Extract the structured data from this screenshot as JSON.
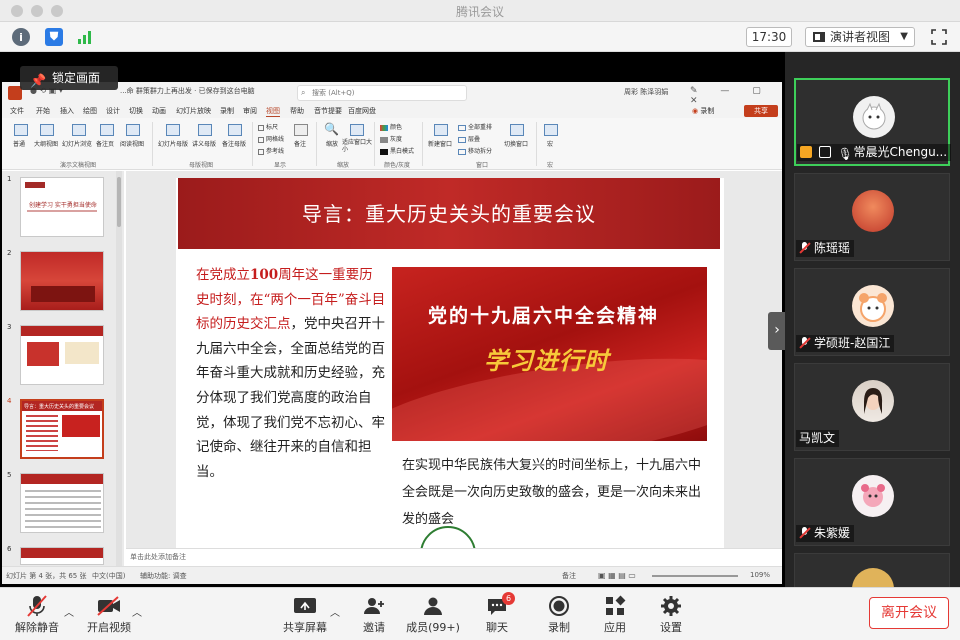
{
  "window": {
    "title": "腾讯会议"
  },
  "toolbar": {
    "time": "17:30",
    "view_mode": "演讲者视图"
  },
  "share": {
    "lock_label": "锁定画面"
  },
  "ppt": {
    "doc_title": "...命 群策群力上再出发 · 已保存到这台电脑",
    "search_placeholder": "搜索 (Alt+Q)",
    "user": "周彩 陈泽羽娟",
    "menu": [
      "文件",
      "开始",
      "插入",
      "绘图",
      "设计",
      "切换",
      "动画",
      "幻灯片放映",
      "录制",
      "审阅",
      "视图",
      "帮助",
      "音节提要",
      "百度网盘"
    ],
    "active_menu": "视图",
    "record_label": "录制",
    "share_label": "共享",
    "ribbon": {
      "presentation_views": [
        "普通",
        "大纲视图",
        "幻灯片浏览",
        "备注页",
        "阅读视图"
      ],
      "group_presentation": "演示文稿视图",
      "master_views": [
        "幻灯片母版",
        "讲义母版",
        "备注母版"
      ],
      "group_master": "母版视图",
      "show_items": [
        "标尺",
        "网格线",
        "参考线"
      ],
      "notes_label": "备注",
      "group_show": "显示",
      "zoom_items": [
        "缩放",
        "适应窗口大小"
      ],
      "group_zoom": "缩放",
      "color_items": [
        "颜色",
        "灰度",
        "黑白模式"
      ],
      "group_color": "颜色/灰度",
      "window_items": [
        "新建窗口",
        "全部重排",
        "层叠",
        "移动拆分",
        "切换窗口"
      ],
      "group_window": "窗口",
      "macro_label": "宏",
      "group_macro": "宏"
    },
    "slide_numbers": [
      "1",
      "2",
      "3",
      "4",
      "5",
      "6"
    ],
    "thumb1_title": "创建学习 实干勇担当使命",
    "thumb4_title": "导言：重大历史关头的重要会议",
    "notes_placeholder": "单击此处添加备注",
    "status": {
      "slide_info": "幻灯片 第 4 张，共 65 张",
      "language": "中文(中国)",
      "accessibility": "辅助功能: 调查",
      "notes": "备注",
      "zoom": "109%"
    }
  },
  "slide": {
    "title": "导言：重大历史关头的重要会议",
    "left_red_1": "在党成立",
    "left_red_bold": "100",
    "left_red_2": "周年这一重要历史时刻，在“两个一百年”奋斗目标的历史交汇点",
    "left_black": "，党中央召开十九届六中全会，全面总结党的百年奋斗重大成就和历史经验，充分体现了我们党高度的政治自觉，体现了我们党不忘初心、牢记使命、继往开来的自信和担当。",
    "image_line1": "党的十九届六中全会精神",
    "image_line2": "学习进行时",
    "right_text": "在实现中华民族伟大复兴的时间坐标上，十九届六中全会既是一次向历史致敬的盛会，更是一次向未来出发的盛会"
  },
  "participants": [
    {
      "name": "常晨光Chengu...",
      "active": true,
      "avatar_bg": "#f1f1f1"
    },
    {
      "name": "陈瑶瑶",
      "active": false,
      "avatar_bg": "#d8452e"
    },
    {
      "name": "学硕班-赵国江",
      "active": false,
      "avatar_bg": "#f5a46a"
    },
    {
      "name": "马凯文",
      "active": false,
      "avatar_bg": "#e8ddd3"
    },
    {
      "name": "朱紫媛",
      "active": false,
      "avatar_bg": "#f6f0f2"
    }
  ],
  "controls": {
    "mute": "解除静音",
    "video": "开启视频",
    "share": "共享屏幕",
    "invite": "邀请",
    "members": "成员(99+)",
    "chat": "聊天",
    "chat_badge": "6",
    "record": "录制",
    "apps": "应用",
    "settings": "设置",
    "leave": "离开会议"
  },
  "colors": {
    "accent_red": "#e53935",
    "active_green": "#3ecf5a",
    "slide_red": "#c02a27"
  }
}
